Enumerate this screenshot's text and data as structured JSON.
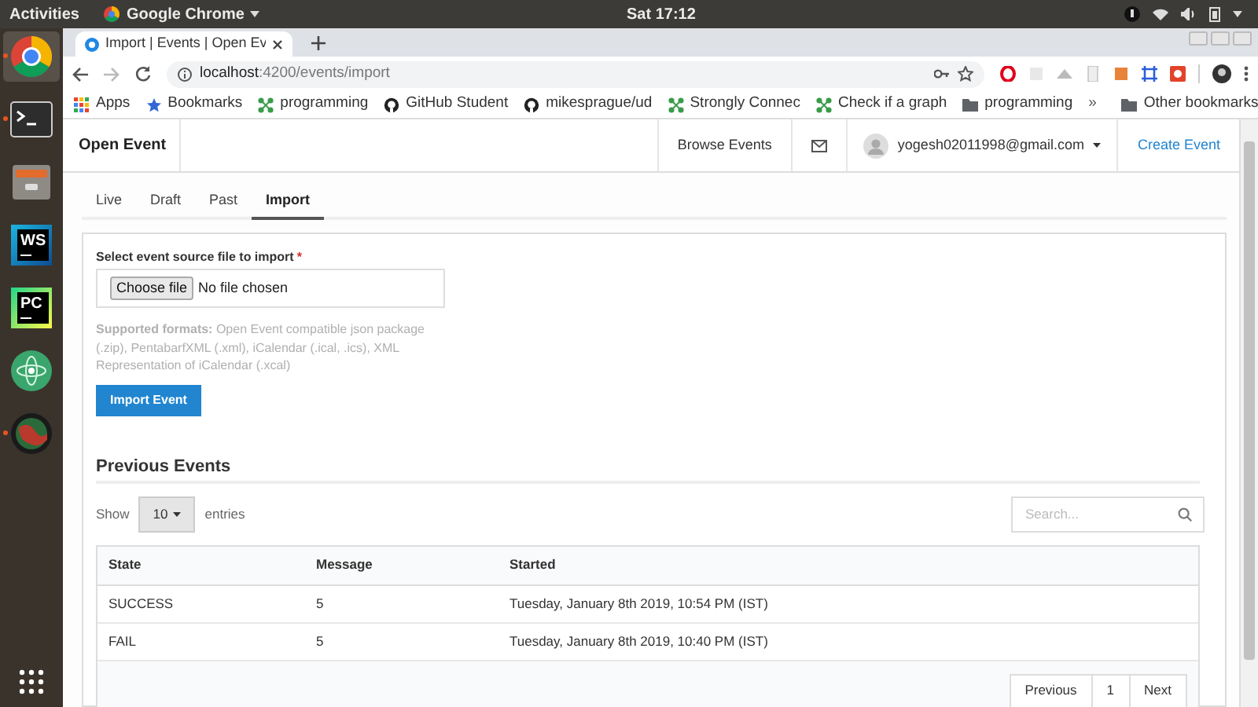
{
  "system_bar": {
    "activities": "Activities",
    "app": "Google Chrome",
    "clock": "Sat 17:12"
  },
  "dock": [
    {
      "kind": "chrome",
      "running": true
    },
    {
      "kind": "terminal",
      "running": true
    },
    {
      "kind": "files",
      "running": false
    },
    {
      "kind": "ide",
      "label": "WS",
      "running": false
    },
    {
      "kind": "ide",
      "label": "PC",
      "running": false
    },
    {
      "kind": "atom",
      "running": false
    },
    {
      "kind": "globe",
      "running": true
    }
  ],
  "browser": {
    "tab_title": "Import | Events | Open Ev",
    "url_host": "localhost",
    "url_path": ":4200/events/import",
    "bookmarks": [
      {
        "kind": "apps",
        "label": "Apps"
      },
      {
        "kind": "star",
        "label": "Bookmarks"
      },
      {
        "kind": "graph",
        "label": "programming"
      },
      {
        "kind": "github",
        "label": "GitHub Student"
      },
      {
        "kind": "github",
        "label": "mikesprague/ud"
      },
      {
        "kind": "graph",
        "label": "Strongly Connec"
      },
      {
        "kind": "graph",
        "label": "Check if a graph"
      },
      {
        "kind": "folder",
        "label": "programming"
      }
    ],
    "overflow": "»",
    "other_bookmarks": "Other bookmarks"
  },
  "navbar": {
    "brand": "Open Event",
    "browse": "Browse Events",
    "email": "yogesh02011998@gmail.com",
    "create": "Create Event"
  },
  "tabs": [
    {
      "label": "Live",
      "selected": false
    },
    {
      "label": "Draft",
      "selected": false
    },
    {
      "label": "Past",
      "selected": false
    },
    {
      "label": "Import",
      "selected": true
    }
  ],
  "form": {
    "label": "Select event source file to import",
    "required_mark": "*",
    "choose_button": "Choose file",
    "file_status": "No file chosen",
    "help": "**Supported formats:** Open Event compatible json package (.zip), PentabarfXML (.xml), iCalendar (.ical, .ics), XML Representation of iCalendar (.xcal)",
    "submit": "Import Event"
  },
  "previous": {
    "title": "Previous Events",
    "show": "Show",
    "page_size": "10",
    "entries": "entries",
    "search": {
      "placeholder": "Search..."
    },
    "table": {
      "columns": [
        "State",
        "Message",
        "Started"
      ],
      "rows": [
        [
          "SUCCESS",
          "5",
          "Tuesday, January 8th 2019, 10:54 PM (IST)"
        ],
        [
          "FAIL",
          "5",
          "Tuesday, January 8th 2019, 10:40 PM (IST)"
        ]
      ]
    },
    "pagination": [
      "Previous",
      "1",
      "Next"
    ]
  }
}
